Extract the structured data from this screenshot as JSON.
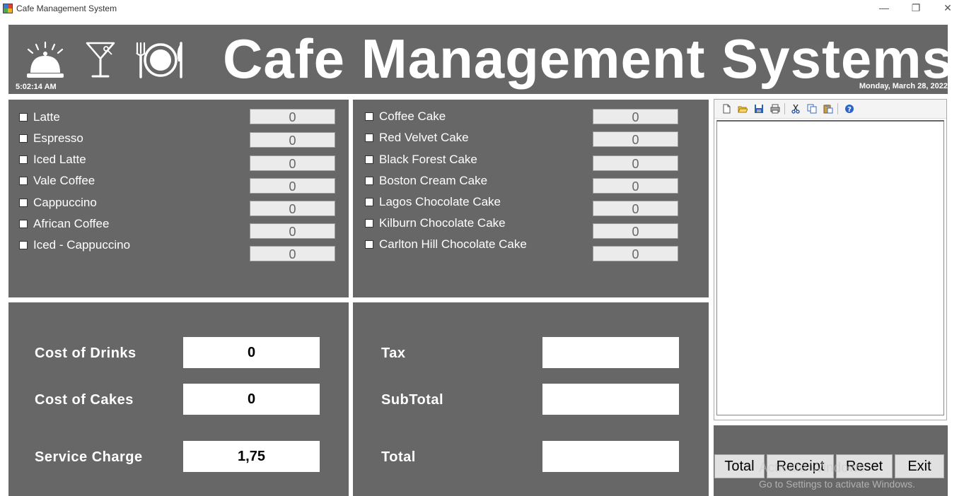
{
  "window": {
    "title": "Cafe Management System",
    "minimize_glyph": "—",
    "restore_glyph": "❐",
    "close_glyph": "✕"
  },
  "header": {
    "title": "Cafe Management Systems",
    "time": "5:02:14 AM",
    "date": "Monday, March 28, 2022",
    "icons": [
      "service-bell-icon",
      "cocktail-glass-icon",
      "plate-cutlery-icon"
    ]
  },
  "drinks": {
    "items": [
      {
        "label": "Latte",
        "qty": "0"
      },
      {
        "label": "Espresso",
        "qty": "0"
      },
      {
        "label": "Iced Latte",
        "qty": "0"
      },
      {
        "label": "Vale Coffee",
        "qty": "0"
      },
      {
        "label": "Cappuccino",
        "qty": "0"
      },
      {
        "label": "African Coffee",
        "qty": "0"
      },
      {
        "label": "Iced - Cappuccino",
        "qty": "0"
      }
    ],
    "extra_qty": "0"
  },
  "cakes": {
    "items": [
      {
        "label": "Coffee Cake",
        "qty": "0"
      },
      {
        "label": "Red Velvet Cake",
        "qty": "0"
      },
      {
        "label": "Black Forest Cake",
        "qty": "0"
      },
      {
        "label": "Boston Cream Cake",
        "qty": "0"
      },
      {
        "label": "Lagos Chocolate Cake",
        "qty": "0"
      },
      {
        "label": "Kilburn Chocolate Cake",
        "qty": "0"
      },
      {
        "label": "Carlton Hill Chocolate Cake",
        "qty": "0"
      }
    ]
  },
  "costs": {
    "drinks_label": "Cost of Drinks",
    "drinks_value": "0",
    "cakes_label": "Cost of Cakes",
    "cakes_value": "0",
    "service_label": "Service Charge",
    "service_value": "1,75"
  },
  "totals": {
    "tax_label": "Tax",
    "tax_value": "",
    "subtotal_label": "SubTotal",
    "subtotal_value": "",
    "total_label": "Total",
    "total_value": ""
  },
  "receipt": {
    "toolbar": [
      "new-icon",
      "open-icon",
      "save-icon",
      "print-icon",
      "cut-icon",
      "copy-icon",
      "paste-icon",
      "help-icon"
    ],
    "content": ""
  },
  "buttons": {
    "total": "Total",
    "receipt": "Receipt",
    "reset": "Reset",
    "exit": "Exit"
  },
  "watermark": {
    "line1": "Activate Windows",
    "line2": "Go to Settings to activate Windows."
  },
  "colors": {
    "panel": "#676767",
    "text": "#ffffff",
    "qty_bg": "#ebebeb"
  }
}
